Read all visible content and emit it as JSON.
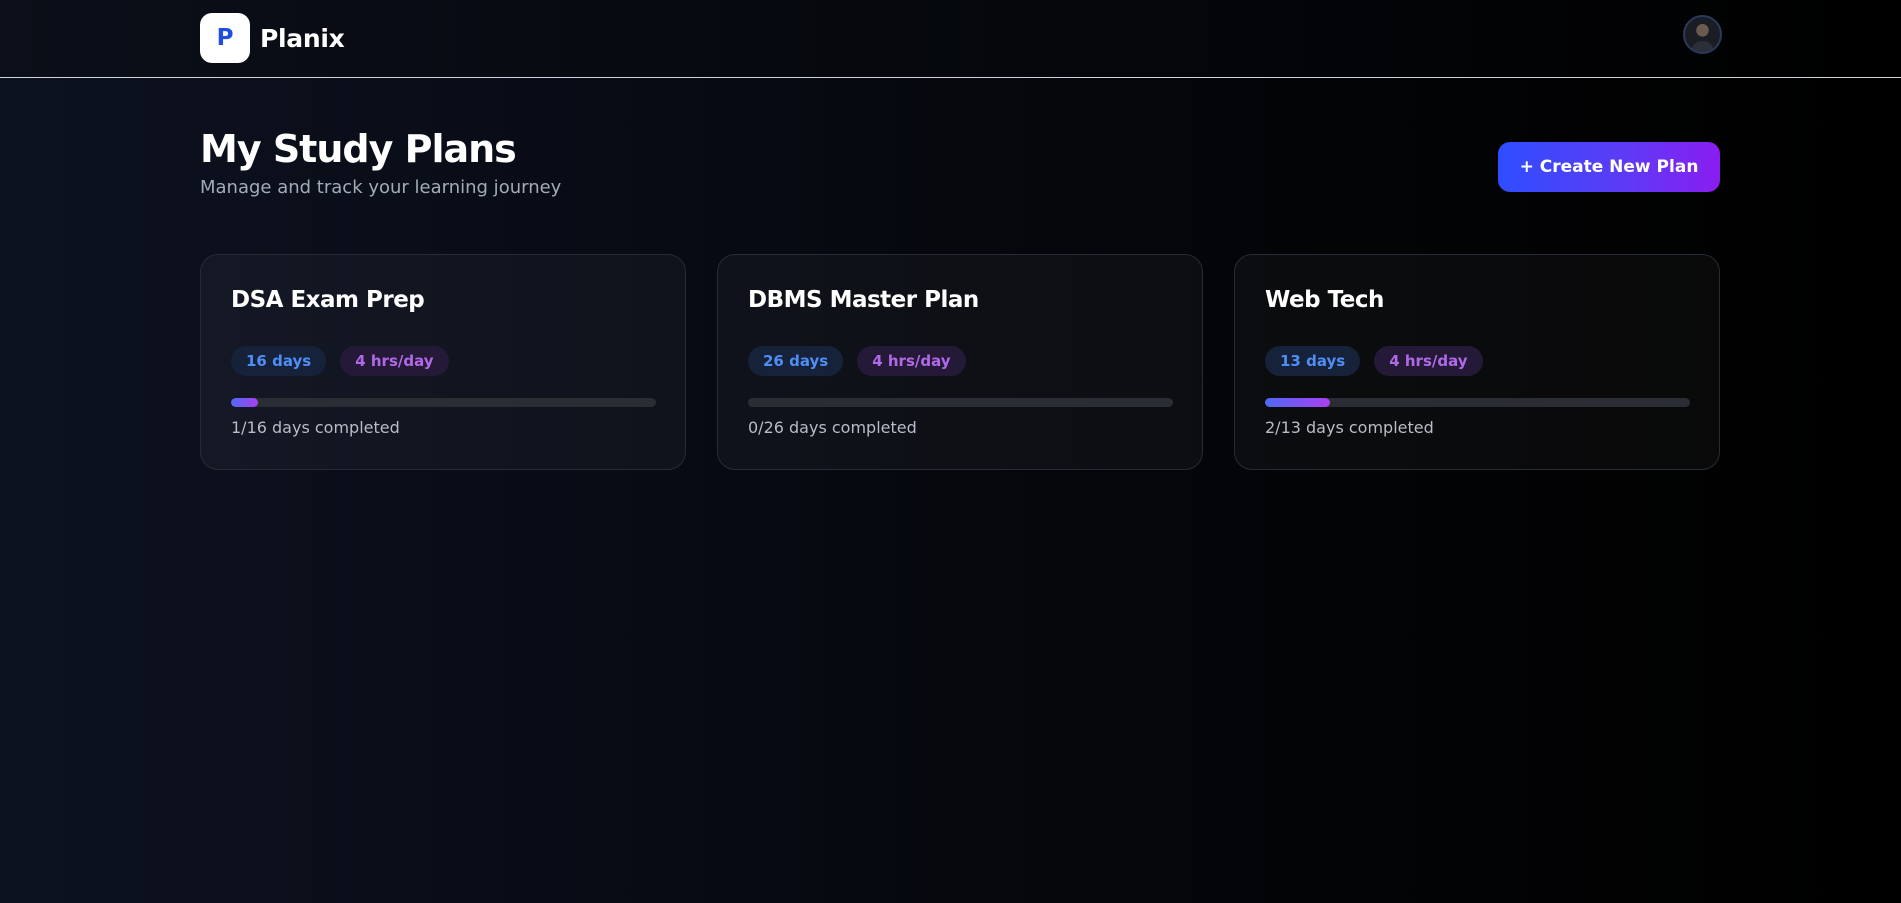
{
  "navbar": {
    "logo_letter": "P",
    "brand_name": "Planix"
  },
  "header": {
    "title": "My Study Plans",
    "subtitle": "Manage and track your learning journey",
    "create_button_label": "+ Create New Plan"
  },
  "plans": [
    {
      "title": "DSA Exam Prep",
      "days_tag": "16 days",
      "hours_tag": "4 hrs/day",
      "progress_text": "1/16 days completed",
      "completed": 1,
      "total": 16
    },
    {
      "title": "DBMS Master Plan",
      "days_tag": "26 days",
      "hours_tag": "4 hrs/day",
      "progress_text": "0/26 days completed",
      "completed": 0,
      "total": 26
    },
    {
      "title": "Web Tech",
      "days_tag": "13 days",
      "hours_tag": "4 hrs/day",
      "progress_text": "2/13 days completed",
      "completed": 2,
      "total": 13
    }
  ],
  "colors": {
    "accent_start": "#2f4dff",
    "accent_end": "#8a1df0",
    "days_tag_text": "#4f8ef5",
    "hours_tag_text": "#b169e8"
  }
}
